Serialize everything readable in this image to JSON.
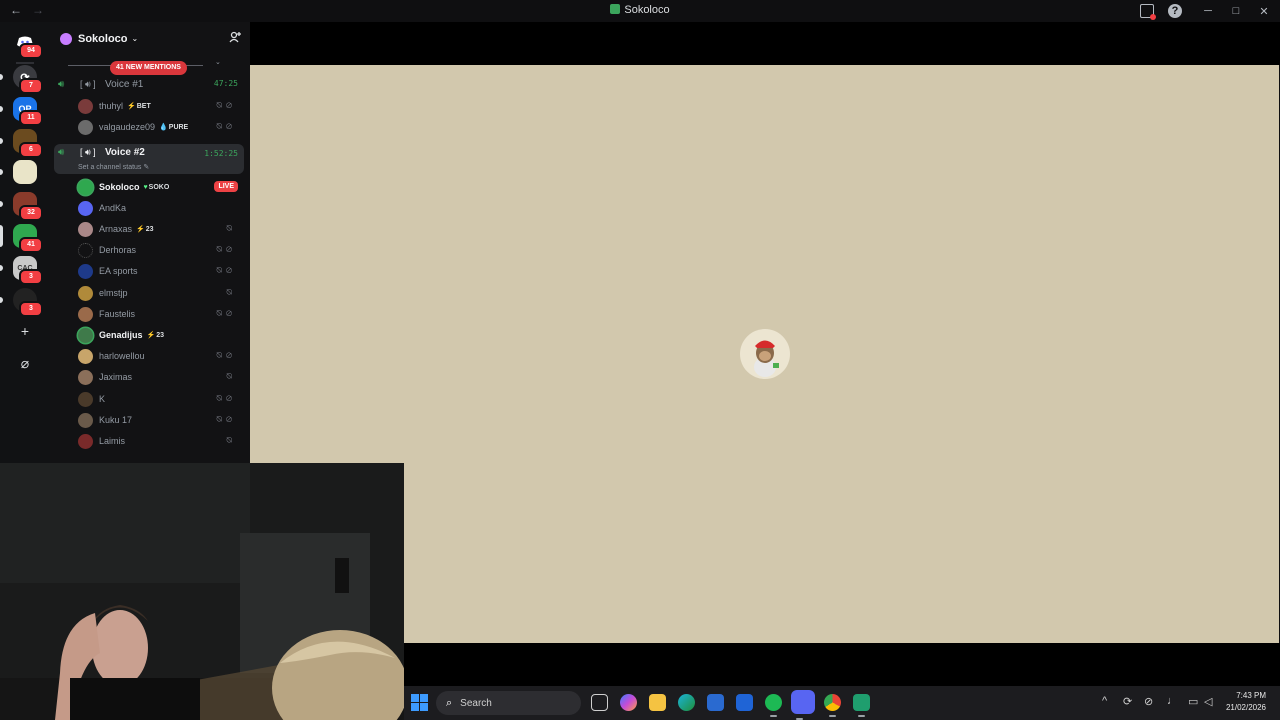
{
  "window": {
    "title": "Sokoloco",
    "back_label": "←",
    "forward_label": "→",
    "help_label": "?",
    "minimize_label": "─",
    "maximize_label": "□",
    "close_label": "✕"
  },
  "rail": {
    "servers": [
      {
        "name": "direct-messages",
        "badge": "94",
        "color": "#5865f2"
      },
      {
        "name": "server-1",
        "badge": "7",
        "color": "#3a3b40"
      },
      {
        "name": "server-2",
        "badge": "11",
        "color": "#1a73e8"
      },
      {
        "name": "server-3",
        "badge": "6",
        "color": "#6b4b1f"
      },
      {
        "name": "server-4",
        "badge": "",
        "color": "#e9e4c8"
      },
      {
        "name": "server-5",
        "badge": "32",
        "color": "#8a3b2b"
      },
      {
        "name": "server-6",
        "badge": "41",
        "color": "#2fa84f"
      },
      {
        "name": "server-7",
        "badge": "3",
        "color": "#c9c9c9"
      },
      {
        "name": "server-8",
        "badge": "3",
        "color": "#222"
      }
    ],
    "add_label": "+",
    "discover_label": "⌀"
  },
  "guild": {
    "name": "Sokoloco",
    "mentions": "41 NEW MENTIONS"
  },
  "voice1": {
    "name": "Voice #1",
    "time": "47:25",
    "users": [
      {
        "name": "thuhyl",
        "tag": "BET",
        "tag_icon": "⚡"
      },
      {
        "name": "valgaudeze09",
        "tag": "PURE",
        "tag_icon": "💧"
      }
    ]
  },
  "voice2": {
    "name": "Voice #2",
    "time": "1:52:25",
    "status": "Set a channel status ✎",
    "live_label": "LIVE",
    "users": [
      {
        "name": "Sokoloco",
        "tag": "SOKO",
        "tag_icon": "♥"
      },
      {
        "name": "AndKa",
        "tag": "",
        "tag_icon": ""
      },
      {
        "name": "Arnaxas",
        "tag": "23",
        "tag_icon": "⚡"
      },
      {
        "name": "Derhoras",
        "tag": "",
        "tag_icon": ""
      },
      {
        "name": "EA sports",
        "tag": "",
        "tag_icon": ""
      },
      {
        "name": "elmstjp",
        "tag": "",
        "tag_icon": ""
      },
      {
        "name": "Faustelis",
        "tag": "",
        "tag_icon": ""
      },
      {
        "name": "Genadijus",
        "tag": "23",
        "tag_icon": "⚡"
      },
      {
        "name": "harlowellou",
        "tag": "",
        "tag_icon": ""
      },
      {
        "name": "Jaximas",
        "tag": "",
        "tag_icon": ""
      },
      {
        "name": "K",
        "tag": "",
        "tag_icon": ""
      },
      {
        "name": "Kuku 17",
        "tag": "",
        "tag_icon": ""
      },
      {
        "name": "Laimis",
        "tag": "",
        "tag_icon": ""
      }
    ]
  },
  "taskbar": {
    "search_placeholder": "Search",
    "time": "7:43 PM",
    "date": "21/02/2026"
  },
  "colors": {
    "stream_bg": "#d2c8ad",
    "accent": "#5865f2",
    "speaking": "#3ba55c",
    "live": "#ed4245"
  }
}
